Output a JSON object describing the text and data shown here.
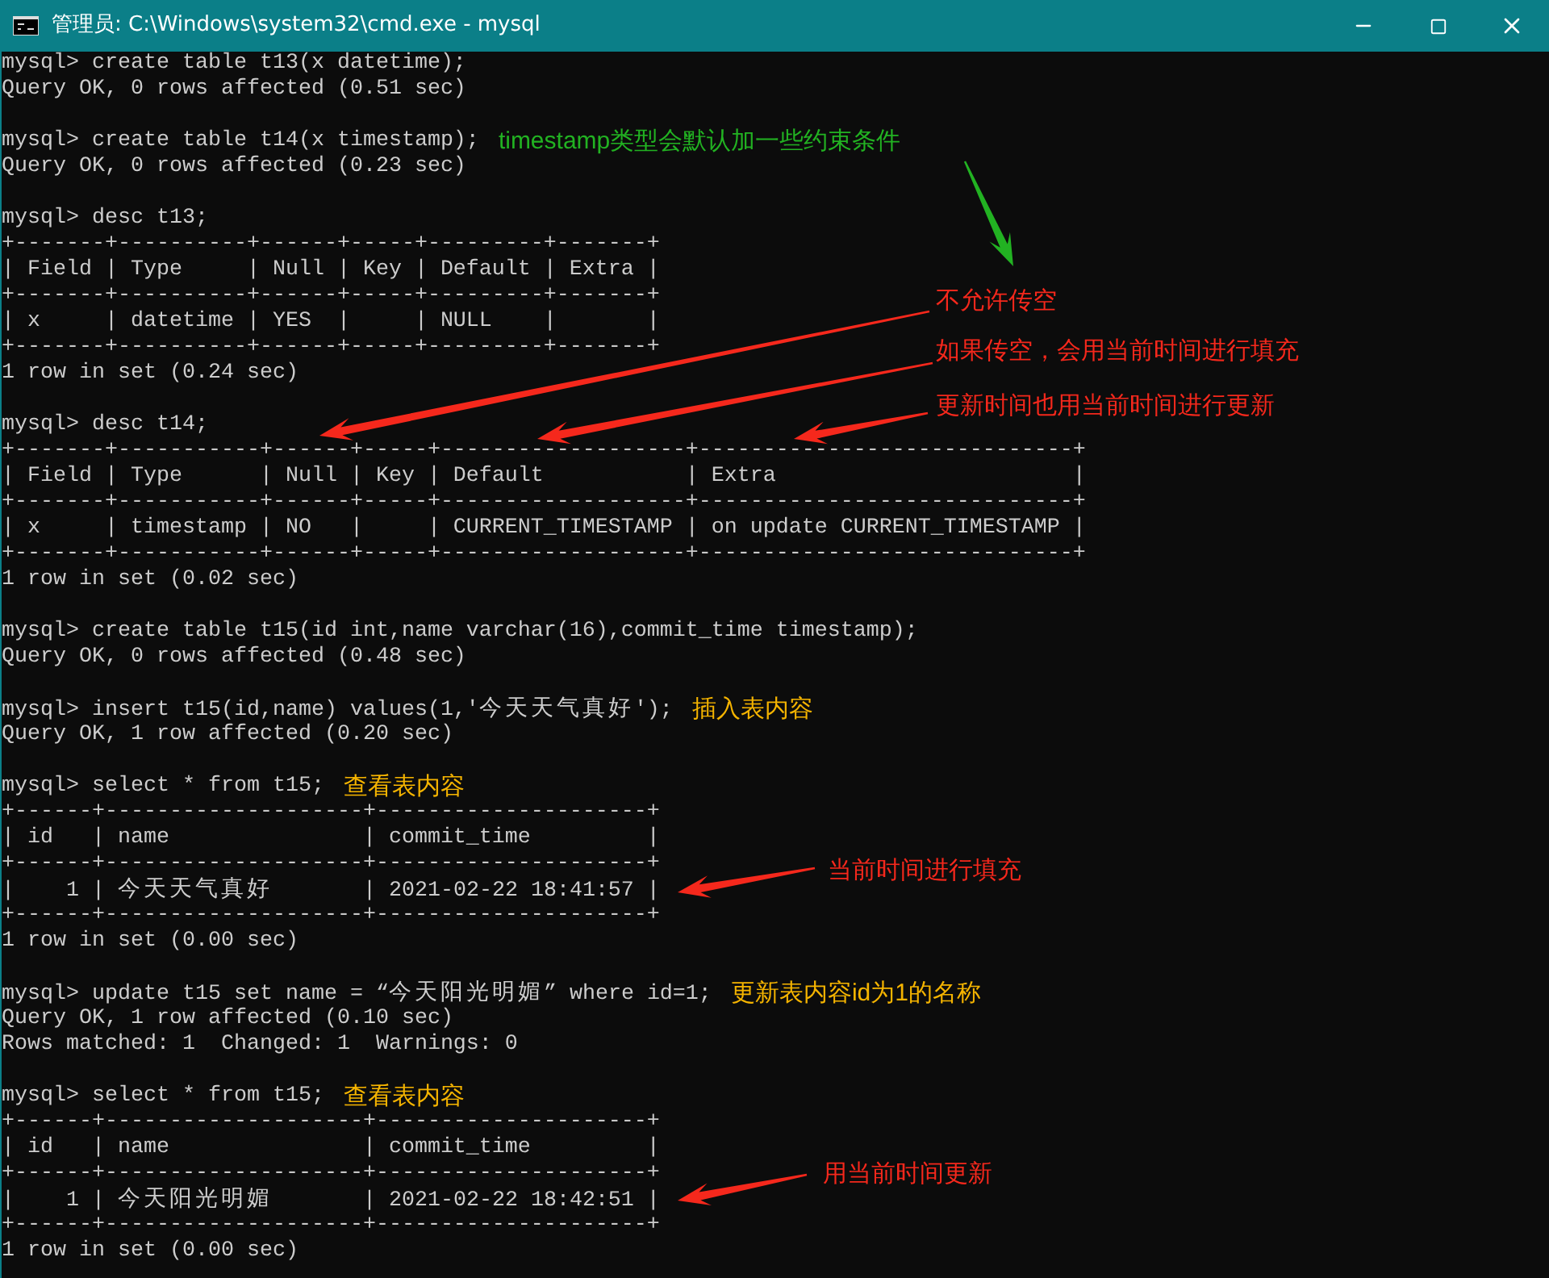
{
  "window": {
    "title": "管理员: C:\\Windows\\system32\\cmd.exe - mysql"
  },
  "blocks": [
    {
      "lines": [
        {
          "text": "mysql> create table t13(x datetime);"
        },
        {
          "text": "Query OK, 0 rows affected (0.51 sec)"
        }
      ]
    },
    {
      "lines": [
        {
          "text": "mysql> create table t14(x timestamp);",
          "note": {
            "text": "timestamp类型会默认加一些约束条件",
            "color": "#22b222"
          }
        },
        {
          "text": "Query OK, 0 rows affected (0.23 sec)"
        }
      ]
    },
    {
      "lines": [
        {
          "text": "mysql> desc t13;"
        },
        {
          "text": "+-------+----------+------+-----+---------+-------+"
        },
        {
          "text": "| Field | Type     | Null | Key | Default | Extra |"
        },
        {
          "text": "+-------+----------+------+-----+---------+-------+"
        },
        {
          "text": "| x     | datetime | YES  |     | NULL    |       |"
        },
        {
          "text": "+-------+----------+------+-----+---------+-------+"
        },
        {
          "text": "1 row in set (0.24 sec)"
        }
      ]
    },
    {
      "lines": [
        {
          "text": "mysql> desc t14;"
        },
        {
          "text": "+-------+-----------+------+-----+-------------------+-----------------------------+"
        },
        {
          "text": "| Field | Type      | Null | Key | Default           | Extra                       |"
        },
        {
          "text": "+-------+-----------+------+-----+-------------------+-----------------------------+"
        },
        {
          "text": "| x     | timestamp | NO   |     | CURRENT_TIMESTAMP | on update CURRENT_TIMESTAMP |"
        },
        {
          "text": "+-------+-----------+------+-----+-------------------+-----------------------------+"
        },
        {
          "text": "1 row in set (0.02 sec)"
        }
      ]
    },
    {
      "lines": [
        {
          "text": "mysql> create table t15(id int,name varchar(16),commit_time timestamp);"
        },
        {
          "text": "Query OK, 0 rows affected (0.48 sec)"
        }
      ]
    },
    {
      "lines": [
        {
          "text": "mysql> insert t15(id,name) values(1,'今天天气真好');",
          "note": {
            "text": "插入表内容",
            "color": "#f5b400"
          }
        },
        {
          "text": "Query OK, 1 row affected (0.20 sec)"
        }
      ]
    },
    {
      "lines": [
        {
          "text": "mysql> select * from t15;",
          "note": {
            "text": "查看表内容",
            "color": "#f5b400"
          }
        },
        {
          "text": "+------+--------------------+---------------------+"
        },
        {
          "text": "| id   | name               | commit_time         |"
        },
        {
          "text": "+------+--------------------+---------------------+"
        },
        {
          "text": "|    1 | 今天天气真好       | 2021-02-22 18:41:57 |"
        },
        {
          "text": "+------+--------------------+---------------------+"
        },
        {
          "text": "1 row in set (0.00 sec)"
        }
      ]
    },
    {
      "lines": [
        {
          "text": "mysql> update t15 set name = “今天阳光明媚” where id=1;",
          "note": {
            "text": "更新表内容id为1的名称",
            "color": "#f5b400"
          }
        },
        {
          "text": "Query OK, 1 row affected (0.10 sec)"
        },
        {
          "text": "Rows matched: 1  Changed: 1  Warnings: 0"
        }
      ]
    },
    {
      "lines": [
        {
          "text": "mysql> select * from t15;",
          "note": {
            "text": "查看表内容",
            "color": "#f5b400"
          }
        },
        {
          "text": "+------+--------------------+---------------------+"
        },
        {
          "text": "| id   | name               | commit_time         |"
        },
        {
          "text": "+------+--------------------+---------------------+"
        },
        {
          "text": "|    1 | 今天阳光明媚       | 2021-02-22 18:42:51 |"
        },
        {
          "text": "+------+--------------------+---------------------+"
        },
        {
          "text": "1 row in set (0.00 sec)"
        }
      ]
    }
  ],
  "annotations": [
    {
      "text": "不允许传空",
      "color": "#f5281c"
    },
    {
      "text": "如果传空，会用当前时间进行填充",
      "color": "#f5281c"
    },
    {
      "text": "更新时间也用当前时间进行更新",
      "color": "#f5281c"
    },
    {
      "text": "当前时间进行填充",
      "color": "#f5281c"
    },
    {
      "text": "用当前时间更新",
      "color": "#f5281c"
    }
  ]
}
